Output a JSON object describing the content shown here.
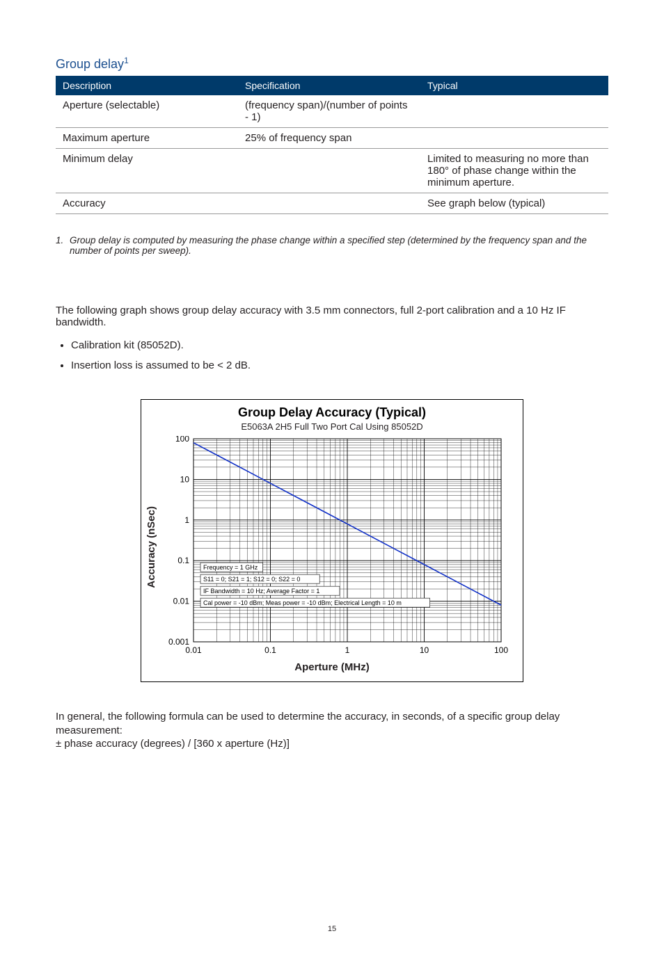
{
  "section_title": "Group delay",
  "section_title_sup": "1",
  "table": {
    "headers": {
      "desc": "Description",
      "spec": "Specification",
      "typ": "Typical"
    },
    "rows": [
      {
        "desc": "Aperture (selectable)",
        "spec": "(frequency span)/(number of points - 1)",
        "typ": ""
      },
      {
        "desc": "Maximum aperture",
        "spec": "25% of frequency span",
        "typ": ""
      },
      {
        "desc": "Minimum delay",
        "spec": "",
        "typ": "Limited to measuring no more than 180° of phase change within the minimum aperture."
      },
      {
        "desc": "Accuracy",
        "spec": "",
        "typ": "See graph below (typical)"
      }
    ]
  },
  "footnote": {
    "num": "1.",
    "text": "Group delay is computed by measuring the phase change within a specified step (determined by the frequency span and the number of points per sweep)."
  },
  "intro": "The following graph shows group delay accuracy with 3.5 mm connectors, full 2-port calibration and a 10 Hz IF bandwidth.",
  "bullets": [
    "Calibration kit (85052D).",
    "Insertion loss is assumed to be < 2 dB."
  ],
  "closing": {
    "line1": "In general, the following formula can be used to determine the accuracy, in seconds, of a specific group delay measurement:",
    "line2": "± phase accuracy (degrees) / [360 x aperture (Hz)]"
  },
  "page_number": "15",
  "chart_data": {
    "type": "line",
    "title": "Group Delay Accuracy (Typical)",
    "subtitle": "E5063A 2H5 Full Two Port Cal Using 85052D",
    "xlabel": "Aperture (MHz)",
    "ylabel": "Accuracy (nSec)",
    "x_scale": "log",
    "y_scale": "log",
    "xlim": [
      0.01,
      100
    ],
    "ylim": [
      0.001,
      100
    ],
    "x_ticks": [
      "0.01",
      "0.1",
      "1",
      "10",
      "100"
    ],
    "y_ticks": [
      "0.001",
      "0.01",
      "0.1",
      "1",
      "10",
      "100"
    ],
    "series": [
      {
        "name": "Accuracy",
        "color": "#1030c8",
        "x": [
          0.01,
          0.02,
          0.05,
          0.1,
          0.2,
          0.5,
          1,
          2,
          5,
          10,
          20,
          50,
          100
        ],
        "y": [
          80,
          40,
          16,
          8,
          4,
          1.6,
          0.8,
          0.4,
          0.16,
          0.08,
          0.04,
          0.016,
          0.008
        ]
      }
    ],
    "annotations": [
      "Frequency = 1 GHz",
      "S11 = 0; S21 = 1; S12 = 0; S22 = 0",
      "IF Bandwidth = 10 Hz; Average Factor = 1",
      "Cal power = -10 dBm; Meas power = -10 dBm; Electrical Length = 10 m"
    ]
  }
}
